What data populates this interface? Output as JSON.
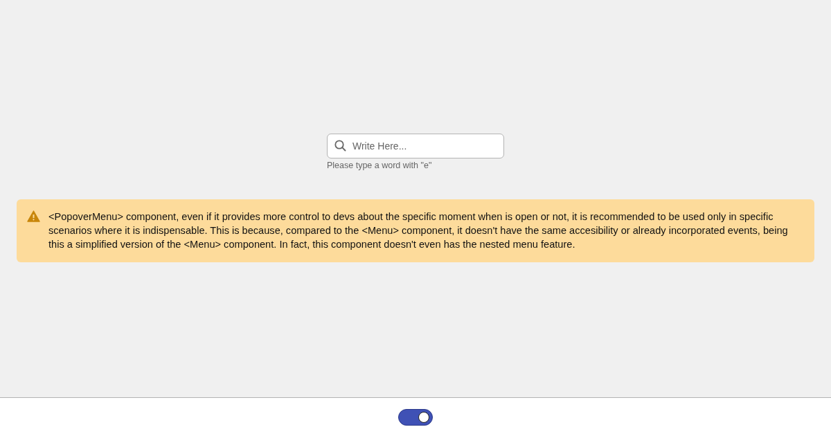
{
  "search": {
    "placeholder": "Write Here...",
    "helper_text": "Please type a word with \"e\""
  },
  "warning": {
    "text": "<PopoverMenu> component, even if it provides more control to devs about the specific moment when is open or not, it is recommended to be used only in specific scenarios where it is indispensable. This is because, compared to the <Menu> component, it doesn't have the same accesibility or already incorporated events, being this a simplified version of the <Menu> component. In fact, this component doesn't even has the nested menu feature."
  },
  "footer": {
    "toggle": {
      "on": true
    }
  }
}
